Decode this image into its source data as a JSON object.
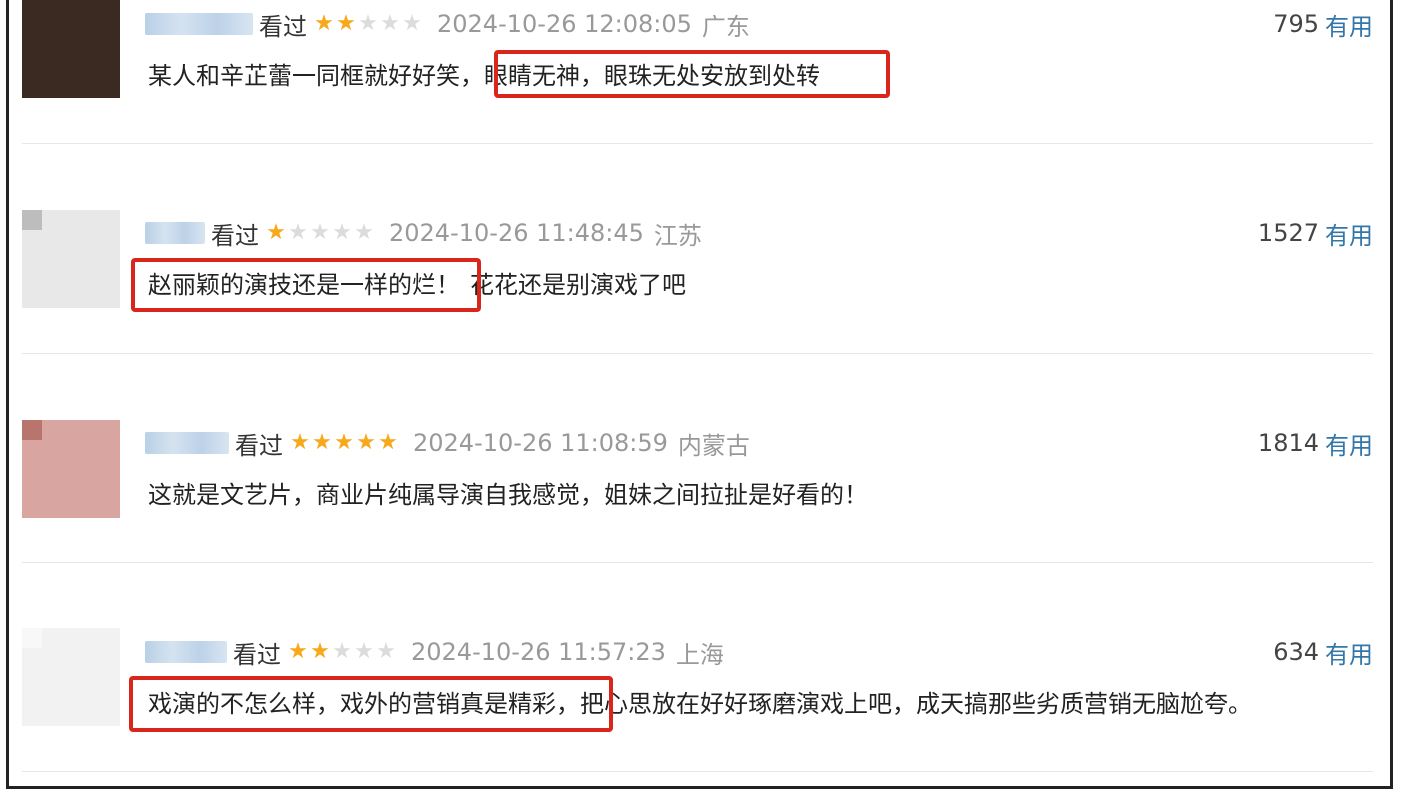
{
  "comments": [
    {
      "watched": "看过",
      "rating": 2,
      "time": "2024-10-26 12:08:05",
      "region": "广东",
      "votes": "795",
      "useful": "有用",
      "text_before": "某人和辛芷蕾一同框就好好笑，",
      "text_highlight": "眼睛无神，眼珠无处安放到处转",
      "text_after": ""
    },
    {
      "watched": "看过",
      "rating": 1,
      "time": "2024-10-26 11:48:45",
      "region": "江苏",
      "votes": "1527",
      "useful": "有用",
      "text_before": "",
      "text_highlight": "赵丽颖的演技还是一样的烂！",
      "text_after": "花花还是别演戏了吧"
    },
    {
      "watched": "看过",
      "rating": 5,
      "time": "2024-10-26 11:08:59",
      "region": "内蒙古",
      "votes": "1814",
      "useful": "有用",
      "text_before": "这就是文艺片，商业片纯属导演自我感觉，姐妹之间拉扯是好看的！",
      "text_highlight": "",
      "text_after": ""
    },
    {
      "watched": "看过",
      "rating": 2,
      "time": "2024-10-26 11:57:23",
      "region": "上海",
      "votes": "634",
      "useful": "有用",
      "text_before": "",
      "text_highlight": "戏演的不怎么样，戏外的营销真是精彩，",
      "text_after": "把心思放在好好琢磨演戏上吧，成天搞那些劣质营销无脑尬夸。"
    }
  ],
  "colors": {
    "star_on": "#f7a81b",
    "star_off": "#dcdcdc",
    "useful_link": "#3377aa",
    "highlight_border": "#d9251c"
  }
}
